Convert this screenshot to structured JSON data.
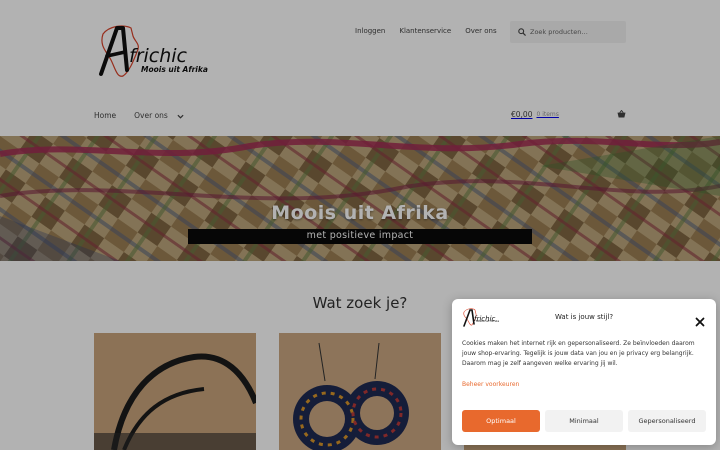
{
  "header": {
    "logo": {
      "title": "Africhic",
      "tagline": "Moois uit Afrika"
    },
    "secondary_nav": [
      "Inloggen",
      "Klantenservice",
      "Over ons"
    ],
    "search": {
      "placeholder": "Zoek producten…",
      "icon": "search-icon"
    },
    "primary_nav": {
      "home": "Home",
      "about": "Over ons"
    },
    "cart": {
      "total": "€0,00",
      "count": "0 items",
      "icon": "basket-icon"
    }
  },
  "hero": {
    "title": "Moois uit Afrika",
    "subtitle": "met positieve impact"
  },
  "main": {
    "heading": "Wat zoek je?"
  },
  "consent": {
    "logo": {
      "title": "Africhic",
      "tagline": "Moois uit Afrika"
    },
    "title": "Wat is jouw stijl?",
    "body": "Cookies maken het internet rijk en gepersonaliseerd. Ze beïnvloeden daarom jouw shop-ervaring. Tegelijk is jouw data van jou en je privacy erg belangrijk. Daarom mag je zelf aangeven welke ervaring jij wil.",
    "manage_link": "Beheer voorkeuren",
    "buttons": {
      "optimal": "Optimaal",
      "minimal": "Minimaal",
      "custom": "Gepersonaliseerd"
    },
    "close_icon": "close-icon"
  },
  "colors": {
    "accent": "#e8692d",
    "overlay": "rgba(0,0,0,0.30)",
    "logo_red": "#e0452b"
  }
}
